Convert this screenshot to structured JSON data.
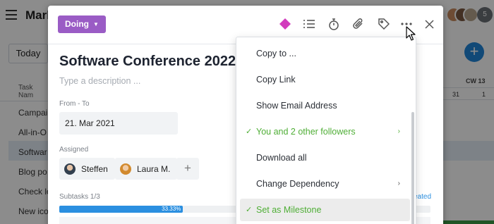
{
  "background": {
    "title": "Mark",
    "today_label": "Today",
    "task_col_header": "Task Nam",
    "tasks": [
      "Campai",
      "All-in-O",
      "Softwar",
      "Blog po",
      "Check lo",
      "New ico"
    ],
    "cw_label": "CW 13",
    "day_31": "31",
    "day_1": "1",
    "avatar_count": "5",
    "fab_label": "+"
  },
  "modal": {
    "status_label": "Doing",
    "icons": [
      "diamond-icon",
      "list-icon",
      "timer-icon",
      "paperclip-icon",
      "tag-icon",
      "more-icon",
      "close-icon"
    ],
    "task_title": "Software Conference 2022",
    "description_placeholder": "Type a description ...",
    "from_to_label": "From - To",
    "date_value": "21. Mar 2021",
    "assigned_label": "Assigned",
    "assignees": [
      "Steffen",
      "Laura M."
    ],
    "add_assignee": "+",
    "subtasks_label": "Subtasks 1/3",
    "subtask_progress": 0.3333,
    "progress_text": "33.33%",
    "link_partial": "eated"
  },
  "menu": {
    "items": [
      {
        "label": "Copy to ..."
      },
      {
        "label": "Copy Link"
      },
      {
        "label": "Show Email Address"
      },
      {
        "label": "You and 2 other followers"
      },
      {
        "label": "Download all"
      },
      {
        "label": "Change Dependency"
      },
      {
        "label": "Set as Milestone"
      }
    ]
  },
  "colors": {
    "status_purple": "#9a5cc5",
    "milestone_pink": "#d23bbd",
    "accent_blue": "#2b8fe0",
    "follower_green": "#4fae36"
  }
}
